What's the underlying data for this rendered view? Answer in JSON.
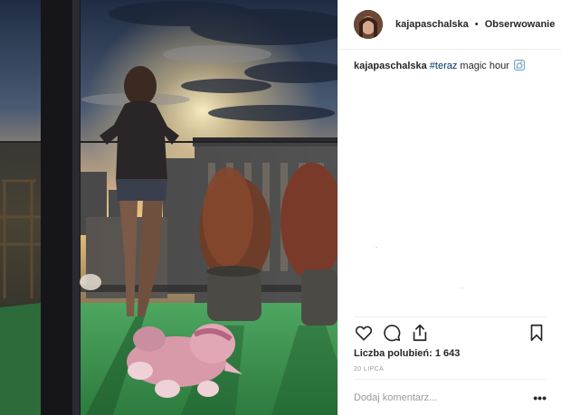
{
  "post": {
    "username": "kajapaschalska",
    "separator": "•",
    "follow_label": "Obserwowanie"
  },
  "caption": {
    "username": "kajapaschalska",
    "hashtag": "#teraz",
    "text": " magic hour",
    "emoji": "unicorn-emoji"
  },
  "actions": {
    "like_icon": "heart-icon",
    "comment_icon": "comment-icon",
    "share_icon": "share-icon",
    "save_icon": "bookmark-icon"
  },
  "likes": {
    "text": "Liczba polubień: 1 643"
  },
  "date": "20 LIPCA",
  "comment": {
    "placeholder": "Dodaj komentarz...",
    "more_label": "•••"
  },
  "photo": {
    "description_icon": "photo",
    "sky_top": "#2e3b52",
    "sunset": "#f2c069",
    "floor": "#3f9a52"
  }
}
